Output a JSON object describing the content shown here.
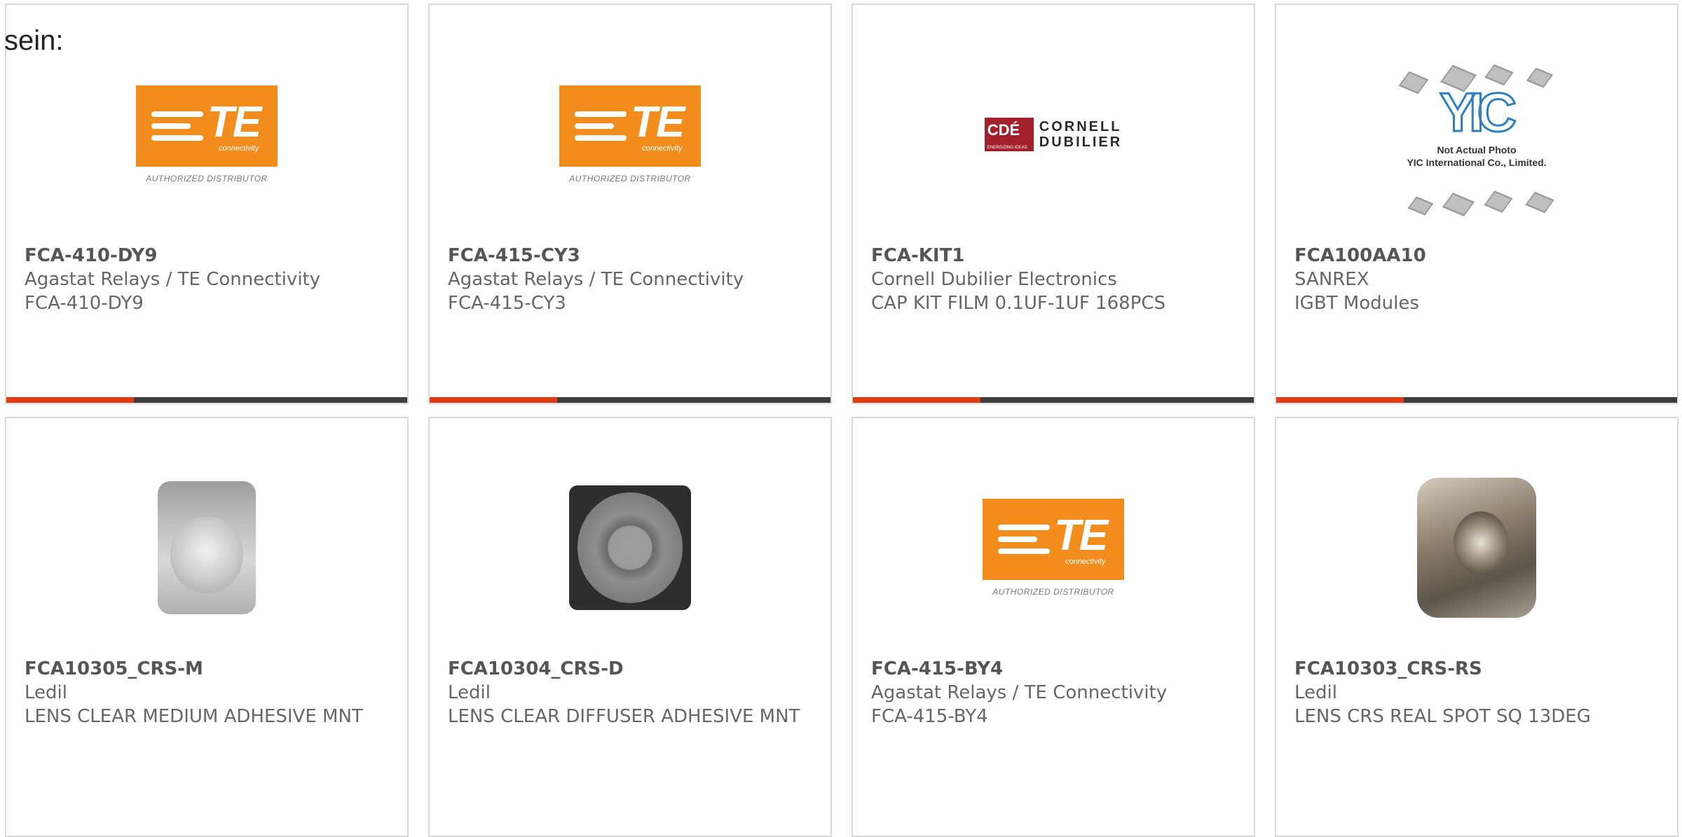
{
  "lead_text": "sein:",
  "colors": {
    "accent": "#e23b0f",
    "bar": "#3d3d3d",
    "te_orange": "#f28c1c",
    "cde_red": "#a31f2b"
  },
  "logos": {
    "te": {
      "word": "TE",
      "tagline": "connectivity",
      "authorized": "AUTHORIZED DISTRIBUTOR"
    },
    "cde": {
      "mark": "CDÉ",
      "tagline": "ENERGIZING IDEAS",
      "name_line1": "CORNELL",
      "name_line2": "DUBILIER"
    },
    "yic": {
      "mark": "YIC",
      "caption_line1": "Not Actual Photo",
      "caption_line2": "YIC International Co., Limited."
    }
  },
  "products": [
    {
      "part": "FCA-410-DY9",
      "maker": "Agastat Relays / TE Connectivity",
      "desc": "FCA-410-DY9",
      "image": "te-logo"
    },
    {
      "part": "FCA-415-CY3",
      "maker": "Agastat Relays / TE Connectivity",
      "desc": "FCA-415-CY3",
      "image": "te-logo"
    },
    {
      "part": "FCA-KIT1",
      "maker": "Cornell Dubilier Electronics",
      "desc": "CAP KIT FILM 0.1UF-1UF 168PCS",
      "image": "cde-logo"
    },
    {
      "part": "FCA100AA10",
      "maker": "SANREX",
      "desc": "IGBT Modules",
      "image": "yic-placeholder"
    },
    {
      "part": "FCA10305_CRS-M",
      "maker": "Ledil",
      "desc": "LENS CLEAR MEDIUM ADHESIVE MNT",
      "image": "lens-clear-photo"
    },
    {
      "part": "FCA10304_CRS-D",
      "maker": "Ledil",
      "desc": "LENS CLEAR DIFFUSER ADHESIVE MNT",
      "image": "lens-diffuser-photo"
    },
    {
      "part": "FCA-415-BY4",
      "maker": "Agastat Relays / TE Connectivity",
      "desc": "FCA-415-BY4",
      "image": "te-logo"
    },
    {
      "part": "FCA10303_CRS-RS",
      "maker": "Ledil",
      "desc": "LENS CRS REAL SPOT SQ 13DEG",
      "image": "lens-spot-photo"
    }
  ]
}
